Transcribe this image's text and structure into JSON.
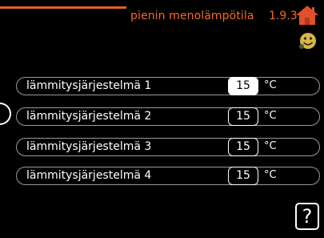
{
  "header": {
    "title": "pienin menolämpötila",
    "menu_number": "1.9.3",
    "accent_color": "#f26a28"
  },
  "icons": {
    "home": "home-icon",
    "status": "smiley-icon"
  },
  "rows": [
    {
      "label": "lämmitysjärjestelmä 1",
      "value": "15",
      "unit": "°C",
      "selected": true
    },
    {
      "label": "lämmitysjärjestelmä 2",
      "value": "15",
      "unit": "°C",
      "selected": false
    },
    {
      "label": "lämmitysjärjestelmä 3",
      "value": "15",
      "unit": "°C",
      "selected": false
    },
    {
      "label": "lämmitysjärjestelmä 4",
      "value": "15",
      "unit": "°C",
      "selected": false
    }
  ],
  "help": {
    "label": "?"
  }
}
